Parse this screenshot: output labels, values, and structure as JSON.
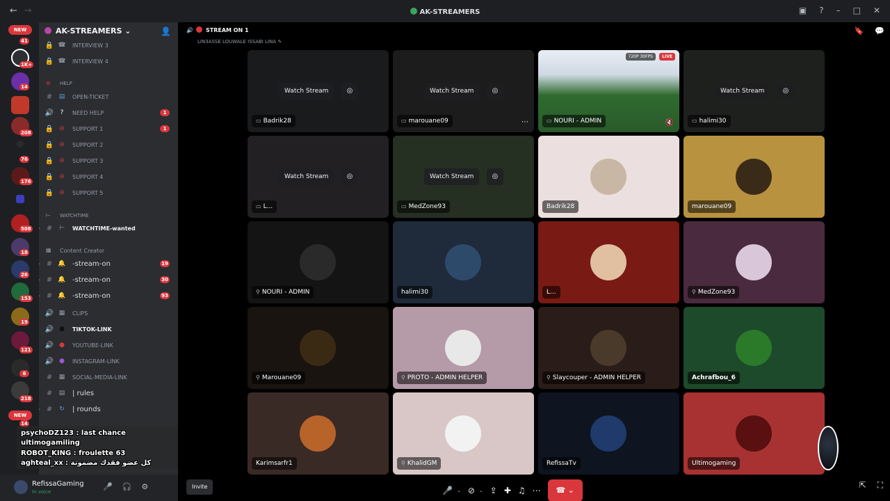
{
  "window": {
    "title": "AK-STREAMERS"
  },
  "rail": {
    "new_top": "NEW",
    "new_bottom": "NEW",
    "badges": [
      "41",
      "1K+",
      "14",
      "208",
      "76",
      "176",
      "508",
      "18",
      "26",
      "153",
      "19",
      "121",
      "6",
      "218",
      "14"
    ]
  },
  "server": {
    "name": "AK-STREAMERS",
    "channels": [
      {
        "icon": "lock-icon",
        "label": "INTERVIEW 3"
      },
      {
        "icon": "lock-icon",
        "label": "INTERVIEW 4"
      }
    ],
    "help_category": "HELP",
    "help_channels": [
      {
        "label": "OPEN-TICKET"
      },
      {
        "label": "NEED HELP",
        "badge": "1"
      },
      {
        "label": "SUPPORT 1",
        "badge": "1"
      },
      {
        "label": "SUPPORT 2"
      },
      {
        "label": "SUPPORT 3"
      },
      {
        "label": "SUPPORT 4"
      },
      {
        "label": "SUPPORT 5"
      }
    ],
    "watchtime_category": "WATCHTIME",
    "watchtime_channel": "WATCHTIME-wanted",
    "content_category": "Content Creator",
    "content_channels": [
      {
        "label": "-stream-on",
        "badge": "19"
      },
      {
        "label": "-stream-on",
        "badge": "30"
      },
      {
        "label": "-stream-on",
        "badge": "93"
      },
      {
        "label": "CLIPS"
      },
      {
        "label": "TIKTOK-LINK"
      },
      {
        "label": "YOUTUBE-LINK"
      },
      {
        "label": "INSTAGRAM-LINK"
      },
      {
        "label": "SOCIAL-MEDIA-LINK"
      },
      {
        "label": "| rules"
      },
      {
        "label": "| rounds"
      }
    ]
  },
  "overlay_chat": [
    "psychoDZ123 : last chance",
    "ultimogamiling",
    "ROBOT_KING : froulette 63",
    "aghteal_xx : كل عضو فقدك مضمونة"
  ],
  "user": {
    "name": "RefissaGaming",
    "status": "In voice"
  },
  "call": {
    "header": "STREAM ON 1",
    "subheader": "LIN3ASSE LOUWALE ISSABI LINA",
    "watch_label": "Watch Stream",
    "tiles": [
      {
        "name": "Badrik28",
        "stream": true
      },
      {
        "name": "marouane09",
        "stream": true,
        "menu": true
      },
      {
        "name": "NOURI - ADMIN",
        "live": true,
        "quality": "720P 30FPS",
        "live_label": "LIVE"
      },
      {
        "name": "halimi30",
        "stream": true
      },
      {
        "name": "L...",
        "stream": true
      },
      {
        "name": "MedZone93",
        "stream": true
      },
      {
        "name": "Badrik28"
      },
      {
        "name": "marouane09"
      },
      {
        "name": "NOURI - ADMIN"
      },
      {
        "name": "halimi30"
      },
      {
        "name": "L..."
      },
      {
        "name": "MedZone93"
      },
      {
        "name": "Marouane09"
      },
      {
        "name": "PROTO - ADMIN HELPER"
      },
      {
        "name": "Slaycouper - ADMIN HELPER"
      },
      {
        "name": "Achrafbou_6"
      },
      {
        "name": "Karimsarfr1"
      },
      {
        "name": "KhalidGM"
      },
      {
        "name": "RefissaTv"
      },
      {
        "name": "Ultimogaming"
      }
    ],
    "invite_label": "Invite"
  },
  "colors": {
    "accent": "#5865f2",
    "danger": "#da373c",
    "online": "#23a55a"
  }
}
